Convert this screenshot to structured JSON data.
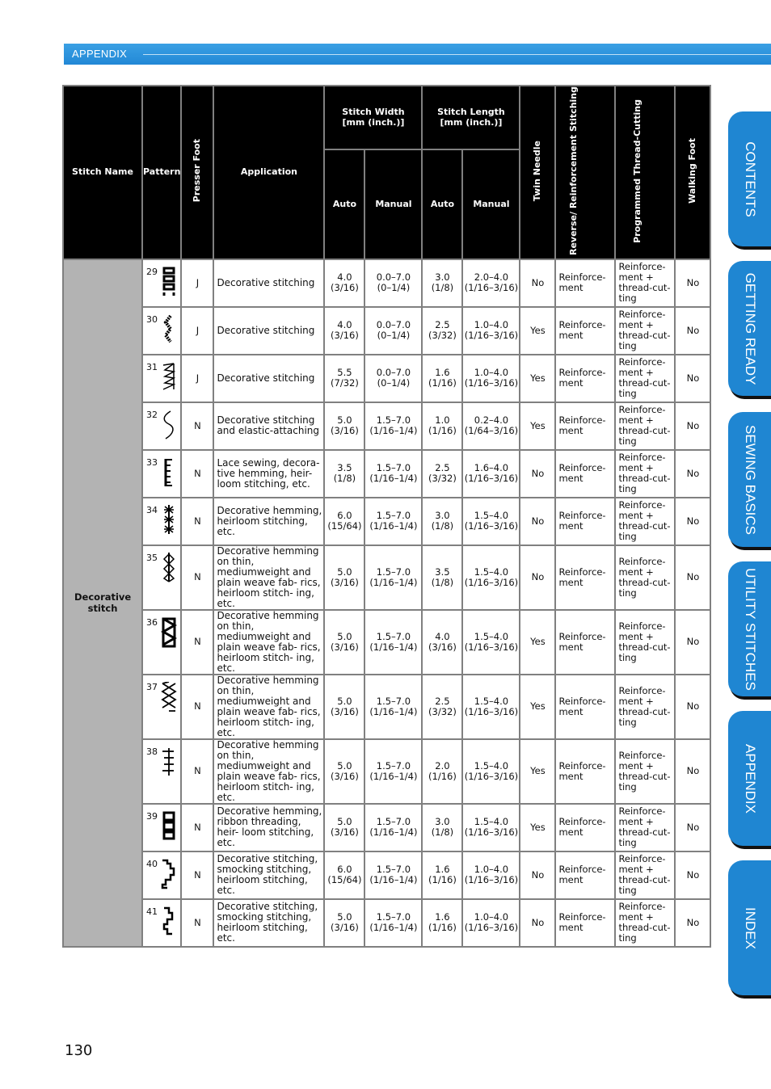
{
  "header": {
    "section_label": "APPENDIX"
  },
  "table": {
    "headers": {
      "stitch_name": "Stitch Name",
      "pattern": "Pattern",
      "presser_foot": "Presser Foot",
      "application": "Application",
      "stitch_width": "Stitch Width [mm (inch.)]",
      "stitch_length": "Stitch Length [mm (inch.)]",
      "auto": "Auto",
      "manual": "Manual",
      "twin_needle": "Twin Needle",
      "reverse": "Reverse/ Reinforcement Stitching",
      "programmed": "Programmed Thread-Cutting",
      "walking_foot": "Walking Foot"
    },
    "group_name": "Decorative stitch",
    "rows": [
      {
        "num": "29",
        "icon": "box-ladder-stitch-icon",
        "foot": "J",
        "application": "Decorative stitching",
        "w_auto": "4.0",
        "w_auto_in": "(3/16)",
        "w_man": "0.0–7.0",
        "w_man_in": "(0–1/4)",
        "l_auto": "3.0",
        "l_auto_in": "(1/8)",
        "l_man": "2.0–4.0",
        "l_man_in": "(1/16–3/16)",
        "twin": "No",
        "reverse": "Reinforce- ment",
        "programmed": "Reinforce- ment + thread-cut- ting",
        "walking": "No"
      },
      {
        "num": "30",
        "icon": "bead-zigzag-stitch-icon",
        "foot": "J",
        "application": "Decorative stitching",
        "w_auto": "4.0",
        "w_auto_in": "(3/16)",
        "w_man": "0.0–7.0",
        "w_man_in": "(0–1/4)",
        "l_auto": "2.5",
        "l_auto_in": "(3/32)",
        "l_man": "1.0–4.0",
        "l_man_in": "(1/16–3/16)",
        "twin": "Yes",
        "reverse": "Reinforce- ment",
        "programmed": "Reinforce- ment + thread-cut- ting",
        "walking": "No"
      },
      {
        "num": "31",
        "icon": "shell-stitch-icon",
        "foot": "J",
        "application": "Decorative stitching",
        "w_auto": "5.5",
        "w_auto_in": "(7/32)",
        "w_man": "0.0–7.0",
        "w_man_in": "(0–1/4)",
        "l_auto": "1.6",
        "l_auto_in": "(1/16)",
        "l_man": "1.0–4.0",
        "l_man_in": "(1/16–3/16)",
        "twin": "Yes",
        "reverse": "Reinforce- ment",
        "programmed": "Reinforce- ment + thread-cut- ting",
        "walking": "No"
      },
      {
        "num": "32",
        "icon": "serpentine-stitch-icon",
        "foot": "N",
        "application": "Decorative stitching and elastic-attaching",
        "w_auto": "5.0",
        "w_auto_in": "(3/16)",
        "w_man": "1.5–7.0",
        "w_man_in": "(1/16–1/4)",
        "l_auto": "1.0",
        "l_auto_in": "(1/16)",
        "l_man": "0.2–4.0",
        "l_man_in": "(1/64–3/16)",
        "twin": "Yes",
        "reverse": "Reinforce- ment",
        "programmed": "Reinforce- ment + thread-cut- ting",
        "walking": "No"
      },
      {
        "num": "33",
        "icon": "comb-stitch-icon",
        "foot": "N",
        "application": "Lace sewing, decora- tive hemming, heir- loom stitching, etc.",
        "w_auto": "3.5",
        "w_auto_in": "(1/8)",
        "w_man": "1.5–7.0",
        "w_man_in": "(1/16–1/4)",
        "l_auto": "2.5",
        "l_auto_in": "(3/32)",
        "l_man": "1.6–4.0",
        "l_man_in": "(1/16–3/16)",
        "twin": "No",
        "reverse": "Reinforce- ment",
        "programmed": "Reinforce- ment + thread-cut- ting",
        "walking": "No"
      },
      {
        "num": "34",
        "icon": "star-stitch-icon",
        "foot": "N",
        "application": "Decorative hemming, heirloom stitching, etc.",
        "w_auto": "6.0",
        "w_auto_in": "(15/64)",
        "w_man": "1.5–7.0",
        "w_man_in": "(1/16–1/4)",
        "l_auto": "3.0",
        "l_auto_in": "(1/8)",
        "l_man": "1.5–4.0",
        "l_man_in": "(1/16–3/16)",
        "twin": "No",
        "reverse": "Reinforce- ment",
        "programmed": "Reinforce- ment + thread-cut- ting",
        "walking": "No"
      },
      {
        "num": "35",
        "icon": "diamond-chain-stitch-icon",
        "foot": "N",
        "application": "Decorative hemming on thin, mediumweight and plain weave fab- rics, heirloom stitch- ing, etc.",
        "w_auto": "5.0",
        "w_auto_in": "(3/16)",
        "w_man": "1.5–7.0",
        "w_man_in": "(1/16–1/4)",
        "l_auto": "3.5",
        "l_auto_in": "(1/8)",
        "l_man": "1.5–4.0",
        "l_man_in": "(1/16–3/16)",
        "twin": "No",
        "reverse": "Reinforce- ment",
        "programmed": "Reinforce- ment + thread-cut- ting",
        "walking": "No"
      },
      {
        "num": "36",
        "icon": "triangle-ladder-stitch-icon",
        "foot": "N",
        "application": "Decorative hemming on thin, mediumweight and plain weave fab- rics, heirloom stitch- ing, etc.",
        "w_auto": "5.0",
        "w_auto_in": "(3/16)",
        "w_man": "1.5–7.0",
        "w_man_in": "(1/16–1/4)",
        "l_auto": "4.0",
        "l_auto_in": "(3/16)",
        "l_man": "1.5–4.0",
        "l_man_in": "(1/16–3/16)",
        "twin": "Yes",
        "reverse": "Reinforce- ment",
        "programmed": "Reinforce- ment + thread-cut- ting",
        "walking": "No"
      },
      {
        "num": "37",
        "icon": "cross-chain-stitch-icon",
        "foot": "N",
        "application": "Decorative hemming on thin, mediumweight and plain weave fab- rics, heirloom stitch- ing, etc.",
        "w_auto": "5.0",
        "w_auto_in": "(3/16)",
        "w_man": "1.5–7.0",
        "w_man_in": "(1/16–1/4)",
        "l_auto": "2.5",
        "l_auto_in": "(3/32)",
        "l_man": "1.5–4.0",
        "l_man_in": "(1/16–3/16)",
        "twin": "Yes",
        "reverse": "Reinforce- ment",
        "programmed": "Reinforce- ment + thread-cut- ting",
        "walking": "No"
      },
      {
        "num": "38",
        "icon": "feather-stitch-icon",
        "foot": "N",
        "application": "Decorative hemming on thin, mediumweight and plain weave fab- rics, heirloom stitch- ing, etc.",
        "w_auto": "5.0",
        "w_auto_in": "(3/16)",
        "w_man": "1.5–7.0",
        "w_man_in": "(1/16–1/4)",
        "l_auto": "2.0",
        "l_auto_in": "(1/16)",
        "l_man": "1.5–4.0",
        "l_man_in": "(1/16–3/16)",
        "twin": "Yes",
        "reverse": "Reinforce- ment",
        "programmed": "Reinforce- ment + thread-cut- ting",
        "walking": "No"
      },
      {
        "num": "39",
        "icon": "ribbon-ladder-stitch-icon",
        "foot": "N",
        "application": "Decorative hemming, ribbon threading, heir- loom stitching, etc.",
        "w_auto": "5.0",
        "w_auto_in": "(3/16)",
        "w_man": "1.5–7.0",
        "w_man_in": "(1/16–1/4)",
        "l_auto": "3.0",
        "l_auto_in": "(1/8)",
        "l_man": "1.5–4.0",
        "l_man_in": "(1/16–3/16)",
        "twin": "Yes",
        "reverse": "Reinforce- ment",
        "programmed": "Reinforce- ment + thread-cut- ting",
        "walking": "No"
      },
      {
        "num": "40",
        "icon": "smocking-step-stitch-icon",
        "foot": "N",
        "application": "Decorative stitching, smocking stitching, heirloom stitching, etc.",
        "w_auto": "6.0",
        "w_auto_in": "(15/64)",
        "w_man": "1.5–7.0",
        "w_man_in": "(1/16–1/4)",
        "l_auto": "1.6",
        "l_auto_in": "(1/16)",
        "l_man": "1.0–4.0",
        "l_man_in": "(1/16–3/16)",
        "twin": "No",
        "reverse": "Reinforce- ment",
        "programmed": "Reinforce- ment + thread-cut- ting",
        "walking": "No"
      },
      {
        "num": "41",
        "icon": "smocking-zigzag-stitch-icon",
        "foot": "N",
        "application": "Decorative stitching, smocking stitching, heirloom stitching, etc.",
        "w_auto": "5.0",
        "w_auto_in": "(3/16)",
        "w_man": "1.5–7.0",
        "w_man_in": "(1/16–1/4)",
        "l_auto": "1.6",
        "l_auto_in": "(1/16)",
        "l_man": "1.0–4.0",
        "l_man_in": "(1/16–3/16)",
        "twin": "No",
        "reverse": "Reinforce- ment",
        "programmed": "Reinforce- ment + thread-cut- ting",
        "walking": "No"
      }
    ]
  },
  "side_tabs": [
    {
      "label": "CONTENTS"
    },
    {
      "label": "GETTING READY"
    },
    {
      "label": "SEWING BASICS"
    },
    {
      "label": "UTILITY STITCHES"
    },
    {
      "label": "APPENDIX"
    },
    {
      "label": "INDEX"
    }
  ],
  "colors": {
    "accent": "#1f86d2",
    "header_bg": "#000000",
    "group_bg": "#b3b3b3"
  },
  "page_number": "130"
}
